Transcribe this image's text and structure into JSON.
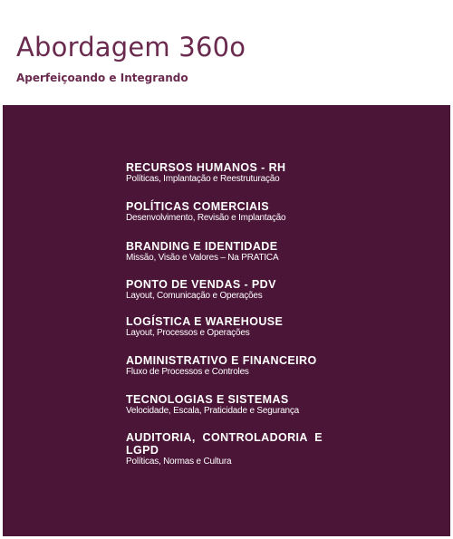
{
  "header": {
    "title": "Abordagem 360o",
    "subtitle": "Aperfeiçoando e Integrando"
  },
  "colors": {
    "brand": "#6a2a4e",
    "panel_background": "#4b1537",
    "panel_text": "#ffffff"
  },
  "items": [
    {
      "title": "RECURSOS HUMANOS - RH",
      "description": "Políticas, Implantação e Reestruturação"
    },
    {
      "title": "POLÍTICAS COMERCIAIS",
      "description": "Desenvolvimento, Revisão e Implantação"
    },
    {
      "title": "BRANDING E IDENTIDADE",
      "description": "Missão, Visão e Valores – Na PRATICA"
    },
    {
      "title": "PONTO DE VENDAS - PDV",
      "description": "Layout, Comunicação e Operações"
    },
    {
      "title": "LOGÍSTICA E WAREHOUSE",
      "description": "Layout, Processos e Operações"
    },
    {
      "title": "ADMINISTRATIVO E FINANCEIRO",
      "description": "Fluxo de Processos e Controles"
    },
    {
      "title": "TECNOLOGIAS E SISTEMAS",
      "description": "Velocidade, Escala, Praticidade e Segurança"
    },
    {
      "title": "AUDITORIA, CONTROLADORIA E LGPD",
      "description": "Políticas, Normas e Cultura"
    }
  ]
}
